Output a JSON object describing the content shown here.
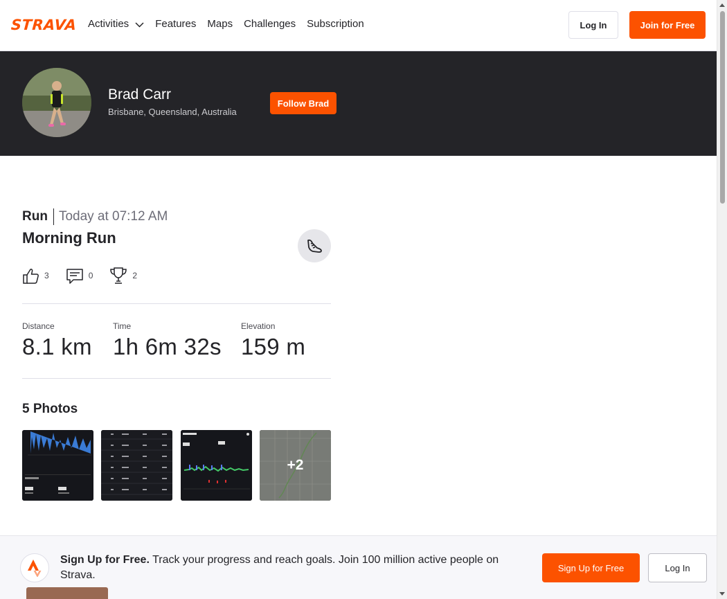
{
  "header": {
    "logo": "STRAVA",
    "nav": [
      "Activities",
      "Features",
      "Maps",
      "Challenges",
      "Subscription"
    ],
    "login_label": "Log In",
    "join_label": "Join for Free"
  },
  "athlete": {
    "name": "Brad Carr",
    "location": "Brisbane, Queensland, Australia",
    "follow_label": "Follow Brad"
  },
  "activity": {
    "type": "Run",
    "time": "Today at 07:12 AM",
    "title": "Morning Run",
    "kudos": "3",
    "comments": "0",
    "achievements": "2",
    "stats": [
      {
        "label": "Distance",
        "value": "8.1 km"
      },
      {
        "label": "Time",
        "value": "1h 6m 32s"
      },
      {
        "label": "Elevation",
        "value": "159 m"
      }
    ]
  },
  "photos": {
    "title": "5 Photos",
    "more_label": "+2"
  },
  "signup": {
    "bold": "Sign Up for Free.",
    "text": " Track your progress and reach goals. Join 100 million active people on Strava.",
    "signup_label": "Sign Up for Free",
    "login_label": "Log In"
  },
  "colors": {
    "brand": "#fc5200",
    "banner": "#242428"
  },
  "icons": [
    "chevron-down-icon",
    "kudos-thumb-icon",
    "comment-icon",
    "trophy-icon",
    "run-shoe-icon",
    "strava-arrow-icon"
  ]
}
